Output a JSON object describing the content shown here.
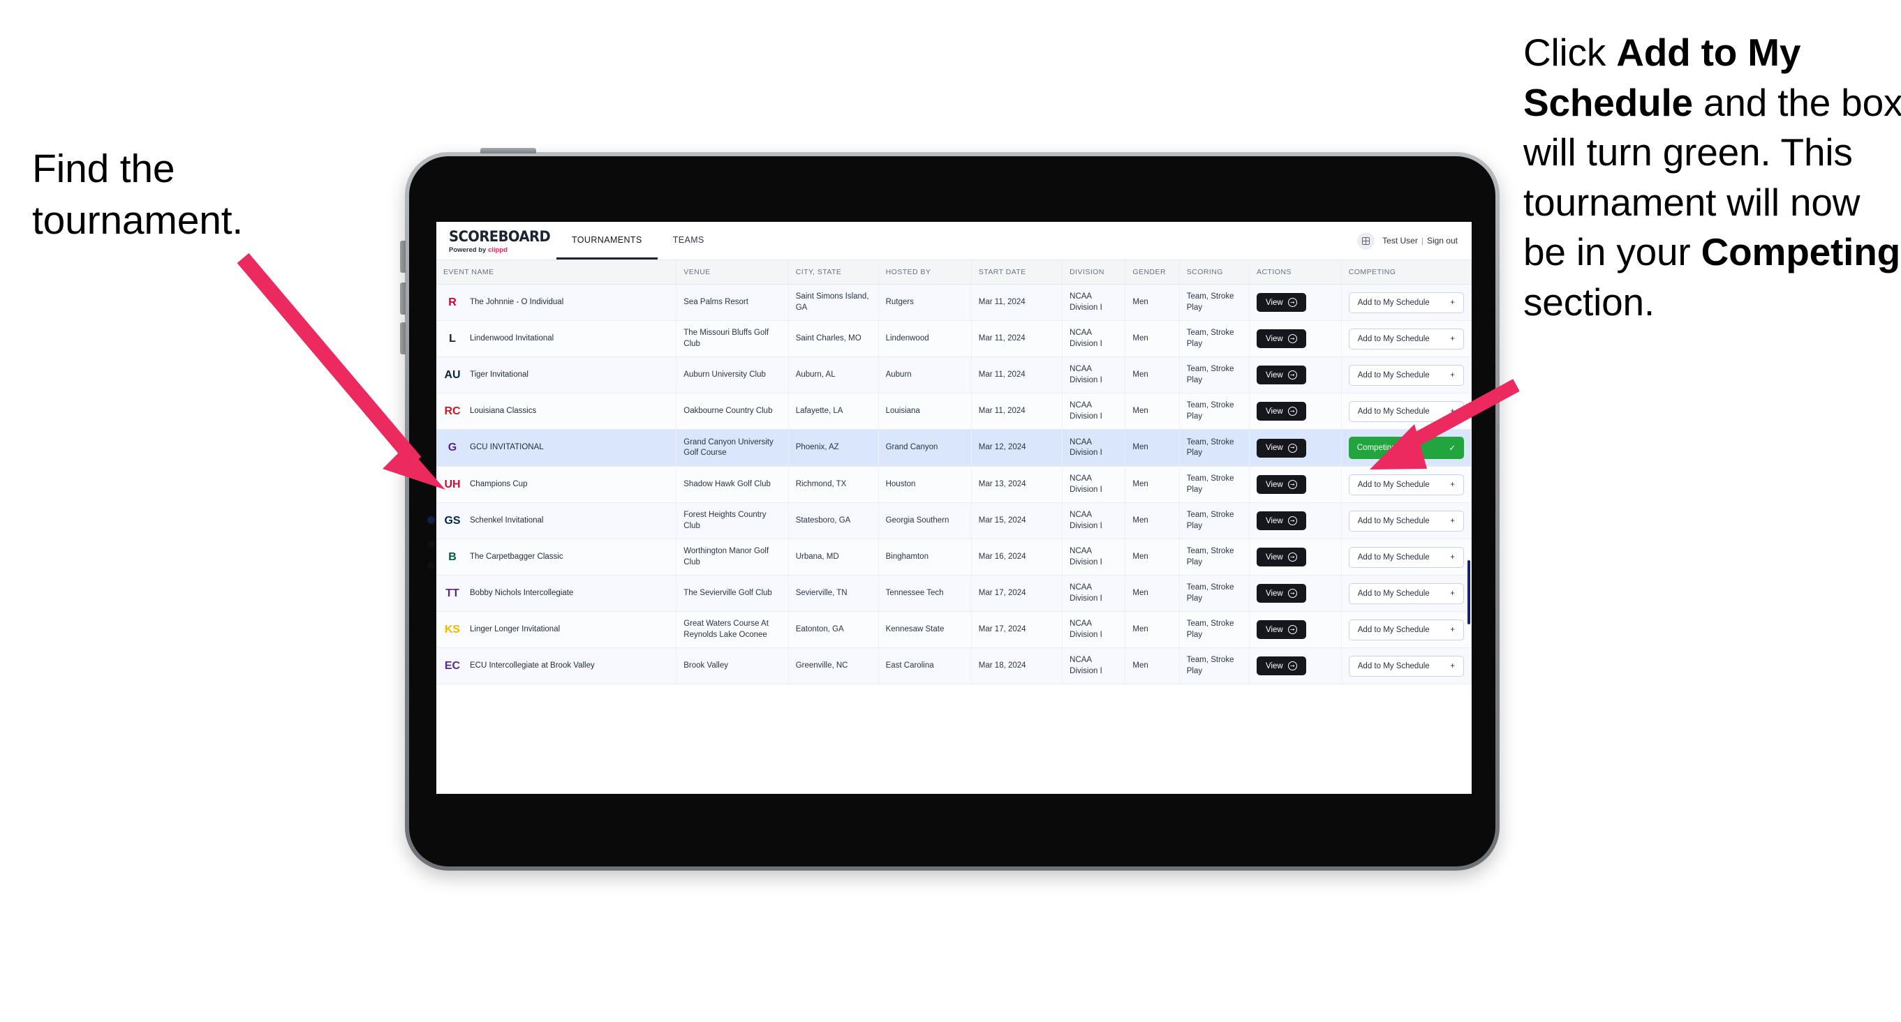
{
  "annotations": {
    "left": {
      "line1": "Find the",
      "line2": "tournament."
    },
    "right": {
      "seg1": "Click ",
      "bold1": "Add to My Schedule",
      "seg2": " and the box will turn green. This tournament will now be in your ",
      "bold2": "Competing",
      "seg3": " section."
    },
    "arrow_color": "#ED2A60"
  },
  "app": {
    "brand": {
      "title": "SCOREBOARD",
      "powered_prefix": "Powered by ",
      "powered_name": "clippd"
    },
    "tabs": [
      {
        "label": "TOURNAMENTS",
        "active": true
      },
      {
        "label": "TEAMS",
        "active": false
      }
    ],
    "account": {
      "avatar_icon": "grid-icon",
      "user": "Test User",
      "separator": "|",
      "signout": "Sign out"
    },
    "table": {
      "columns": [
        "EVENT NAME",
        "VENUE",
        "CITY, STATE",
        "HOSTED BY",
        "START DATE",
        "DIVISION",
        "GENDER",
        "SCORING",
        "ACTIONS",
        "COMPETING"
      ],
      "view_label": "View",
      "add_label": "Add to My Schedule",
      "add_icon": "+",
      "competing_label": "Competing",
      "competing_icon": "check-icon",
      "competing_color": "#22A43F",
      "rows": [
        {
          "event": "The Johnnie - O Individual",
          "venue": "Sea Palms Resort",
          "city": "Saint Simons Island, GA",
          "hosted_by": "Rutgers",
          "start_date": "Mar 11, 2024",
          "division": "NCAA Division I",
          "gender": "Men",
          "scoring": "Team, Stroke Play",
          "competing": false,
          "logo_text": "R",
          "logo_color": "#CC0033"
        },
        {
          "event": "Lindenwood Invitational",
          "venue": "The Missouri Bluffs Golf Club",
          "city": "Saint Charles, MO",
          "hosted_by": "Lindenwood",
          "start_date": "Mar 11, 2024",
          "division": "NCAA Division I",
          "gender": "Men",
          "scoring": "Team, Stroke Play",
          "competing": false,
          "logo_text": "L",
          "logo_color": "#1B1B1B"
        },
        {
          "event": "Tiger Invitational",
          "venue": "Auburn University Club",
          "city": "Auburn, AL",
          "hosted_by": "Auburn",
          "start_date": "Mar 11, 2024",
          "division": "NCAA Division I",
          "gender": "Men",
          "scoring": "Team, Stroke Play",
          "competing": false,
          "logo_text": "AU",
          "logo_color": "#0C2340"
        },
        {
          "event": "Louisiana Classics",
          "venue": "Oakbourne Country Club",
          "city": "Lafayette, LA",
          "hosted_by": "Louisiana",
          "start_date": "Mar 11, 2024",
          "division": "NCAA Division I",
          "gender": "Men",
          "scoring": "Team, Stroke Play",
          "competing": false,
          "logo_text": "RC",
          "logo_color": "#CE181E"
        },
        {
          "event": "GCU INVITATIONAL",
          "venue": "Grand Canyon University Golf Course",
          "city": "Phoenix, AZ",
          "hosted_by": "Grand Canyon",
          "start_date": "Mar 12, 2024",
          "division": "NCAA Division I",
          "gender": "Men",
          "scoring": "Team, Stroke Play",
          "competing": true,
          "logo_text": "G",
          "logo_color": "#522398"
        },
        {
          "event": "Champions Cup",
          "venue": "Shadow Hawk Golf Club",
          "city": "Richmond, TX",
          "hosted_by": "Houston",
          "start_date": "Mar 13, 2024",
          "division": "NCAA Division I",
          "gender": "Men",
          "scoring": "Team, Stroke Play",
          "competing": false,
          "logo_text": "UH",
          "logo_color": "#C8102E"
        },
        {
          "event": "Schenkel Invitational",
          "venue": "Forest Heights Country Club",
          "city": "Statesboro, GA",
          "hosted_by": "Georgia Southern",
          "start_date": "Mar 15, 2024",
          "division": "NCAA Division I",
          "gender": "Men",
          "scoring": "Team, Stroke Play",
          "competing": false,
          "logo_text": "GS",
          "logo_color": "#00274C"
        },
        {
          "event": "The Carpetbagger Classic",
          "venue": "Worthington Manor Golf Club",
          "city": "Urbana, MD",
          "hosted_by": "Binghamton",
          "start_date": "Mar 16, 2024",
          "division": "NCAA Division I",
          "gender": "Men",
          "scoring": "Team, Stroke Play",
          "competing": false,
          "logo_text": "B",
          "logo_color": "#005A43"
        },
        {
          "event": "Bobby Nichols Intercollegiate",
          "venue": "The Sevierville Golf Club",
          "city": "Sevierville, TN",
          "hosted_by": "Tennessee Tech",
          "start_date": "Mar 17, 2024",
          "division": "NCAA Division I",
          "gender": "Men",
          "scoring": "Team, Stroke Play",
          "competing": false,
          "logo_text": "TT",
          "logo_color": "#582C83"
        },
        {
          "event": "Linger Longer Invitational",
          "venue": "Great Waters Course At Reynolds Lake Oconee",
          "city": "Eatonton, GA",
          "hosted_by": "Kennesaw State",
          "start_date": "Mar 17, 2024",
          "division": "NCAA Division I",
          "gender": "Men",
          "scoring": "Team, Stroke Play",
          "competing": false,
          "logo_text": "KS",
          "logo_color": "#F7B500"
        },
        {
          "event": "ECU Intercollegiate at Brook Valley",
          "venue": "Brook Valley",
          "city": "Greenville, NC",
          "hosted_by": "East Carolina",
          "start_date": "Mar 18, 2024",
          "division": "NCAA Division I",
          "gender": "Men",
          "scoring": "Team, Stroke Play",
          "competing": false,
          "logo_text": "EC",
          "logo_color": "#592A8A"
        }
      ]
    }
  }
}
